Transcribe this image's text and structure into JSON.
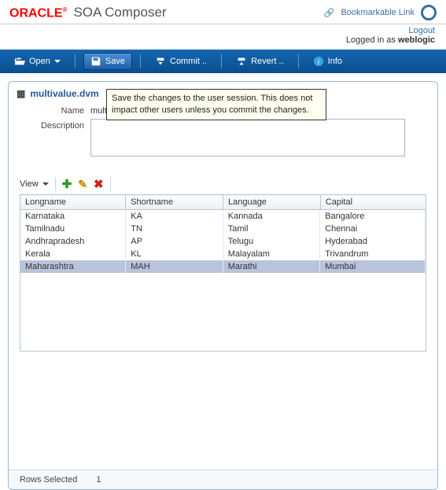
{
  "header": {
    "brand": "ORACLE",
    "app": "SOA Composer",
    "bookmark": "Bookmarkable Link",
    "logout": "Logout",
    "logged_in_prefix": "Logged in as",
    "user": "weblogic"
  },
  "toolbar": {
    "open": "Open",
    "save": "Save",
    "commit": "Commit ..",
    "revert": "Revert ..",
    "info": "Info"
  },
  "tooltip_text": "Save the changes to the user session. This does not impact other users unless you commit the changes.",
  "file": {
    "name": "multivalue.dvm"
  },
  "form": {
    "name_label": "Name",
    "name_value": "multivalue",
    "desc_label": "Description",
    "desc_value": ""
  },
  "grid": {
    "view_label": "View",
    "columns": [
      "Longname",
      "Shortname",
      "Language",
      "Capital"
    ],
    "rows": [
      {
        "cells": [
          "Karnataka",
          "KA",
          "Kannada",
          "Bangalore"
        ],
        "selected": false
      },
      {
        "cells": [
          "Tamilnadu",
          "TN",
          "Tamil",
          "Chennai"
        ],
        "selected": false
      },
      {
        "cells": [
          "Andhrapradesh",
          "AP",
          "Telugu",
          "Hyderabad"
        ],
        "selected": false
      },
      {
        "cells": [
          "Kerala",
          "KL",
          "Malayalam",
          "Trivandrum"
        ],
        "selected": false
      },
      {
        "cells": [
          "Maharashtra",
          "MAH",
          "Marathi",
          "Mumbai"
        ],
        "selected": true
      }
    ]
  },
  "status": {
    "rows_label": "Rows Selected",
    "rows_count": "1"
  }
}
